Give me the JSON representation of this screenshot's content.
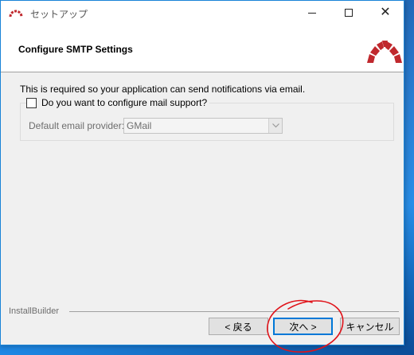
{
  "window": {
    "title": "セットアップ",
    "controls": {
      "minimize_icon": "minimize-icon",
      "maximize_icon": "maximize-icon",
      "close_icon": "close-icon"
    }
  },
  "header": {
    "title": "Configure SMTP Settings",
    "logo_icon": "redmine-logo-icon",
    "accent_color": "#c0282d"
  },
  "content": {
    "description": "This is required so your application can send notifications via email.",
    "mail_support": {
      "label": "Do you want to configure mail support?",
      "checked": false
    },
    "provider": {
      "label": "Default email provider:",
      "selected": "GMail",
      "enabled": false
    }
  },
  "footer": {
    "brand": "InstallBuilder",
    "buttons": {
      "back": "< 戻る",
      "next": "次へ >",
      "cancel": "キャンセル"
    }
  },
  "annotation": {
    "color": "#e0141b",
    "shape": "circle-around-next-button"
  }
}
